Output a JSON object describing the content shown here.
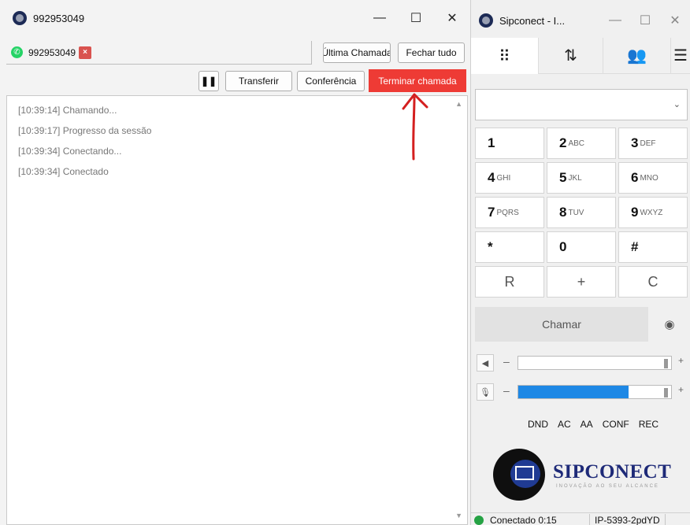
{
  "call_window": {
    "title": "992953049",
    "controls": {
      "minimize": "—",
      "maximize": "☐",
      "close": "✕"
    },
    "session_tab": {
      "number": "992953049",
      "close": "×"
    },
    "last_call_label": "Última Chamada",
    "close_all_label": "Fechar tudo",
    "pause_label": "❚❚",
    "transfer_label": "Transferir",
    "conference_label": "Conferência",
    "hangup_label": "Terminar chamada",
    "log": [
      "[10:39:14] Chamando...",
      "[10:39:17] Progresso da sessão",
      "[10:39:34] Conectando...",
      "[10:39:34] Conectado"
    ]
  },
  "dialer_window": {
    "title": "Sipconect - I...",
    "controls": {
      "minimize": "—",
      "maximize": "☐",
      "close": "✕"
    },
    "keys": [
      {
        "digit": "1",
        "letters": ""
      },
      {
        "digit": "2",
        "letters": "ABC"
      },
      {
        "digit": "3",
        "letters": "DEF"
      },
      {
        "digit": "4",
        "letters": "GHI"
      },
      {
        "digit": "5",
        "letters": "JKL"
      },
      {
        "digit": "6",
        "letters": "MNO"
      },
      {
        "digit": "7",
        "letters": "PQRS"
      },
      {
        "digit": "8",
        "letters": "TUV"
      },
      {
        "digit": "9",
        "letters": "WXYZ"
      },
      {
        "digit": "*",
        "letters": ""
      },
      {
        "digit": "0",
        "letters": ""
      },
      {
        "digit": "#",
        "letters": ""
      },
      {
        "digit": "R",
        "letters": ""
      },
      {
        "digit": "+",
        "letters": ""
      },
      {
        "digit": "C",
        "letters": ""
      }
    ],
    "call_label": "Chamar",
    "speaker": {
      "minus": "–",
      "plus": "+",
      "level_percent": 0
    },
    "mic": {
      "minus": "–",
      "plus": "+",
      "level_percent": 72
    },
    "options": [
      "DND",
      "AC",
      "AA",
      "CONF",
      "REC"
    ],
    "logo": {
      "name": "SIPCONECT",
      "tagline": "INOVAÇÃO AO SEU ALCANCE"
    },
    "status": {
      "text": "Conectado 0:15",
      "extension": "IP-5393-2pdYD"
    }
  },
  "colors": {
    "hangup": "#ee3b35",
    "status_ok": "#25a244",
    "accent_blue": "#1e88e5",
    "brand_navy": "#1e2a78"
  }
}
